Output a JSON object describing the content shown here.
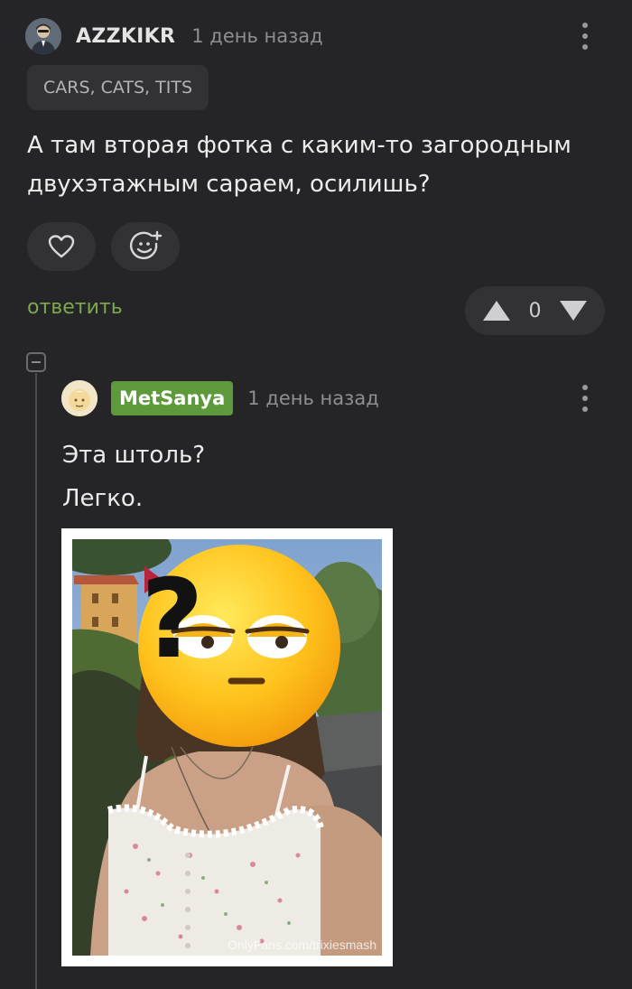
{
  "comment": {
    "author": "AZZKIKR",
    "time": "1 день назад",
    "tag": "CARS, CATS, TITS",
    "text": "А там вторая фотка с каким-то загородным двухэтажным сараем, осилишь?",
    "reply_label": "ответить",
    "rating": "0",
    "icons": {
      "like": "heart-icon",
      "reaction": "emoji-add-icon",
      "more": "more-vertical-icon",
      "up": "arrow-up-icon",
      "down": "arrow-down-icon"
    }
  },
  "reply": {
    "author": "MetSanya",
    "time": "1 день назад",
    "lines": [
      "Эта штоль?",
      "Легко."
    ],
    "image_watermark": "OnlyFans.com/trixiesmash",
    "colors": {
      "author_badge": "#5e9a3c",
      "reply_link": "#7da84f"
    }
  }
}
